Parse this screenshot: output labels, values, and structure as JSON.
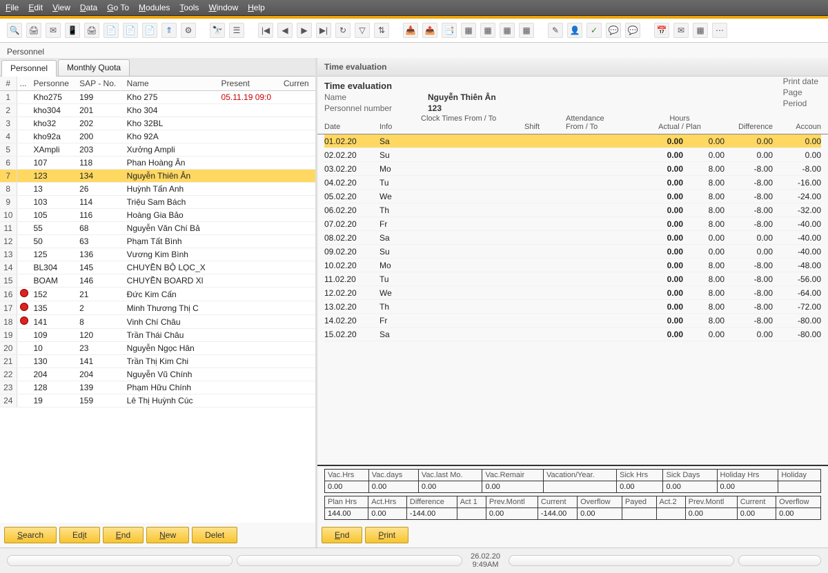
{
  "menu": [
    "File",
    "Edit",
    "View",
    "Data",
    "Go To",
    "Modules",
    "Tools",
    "Window",
    "Help"
  ],
  "crumb": "Personnel",
  "tabs": {
    "personnel": "Personnel",
    "quota": "Monthly Quota"
  },
  "left_cols": {
    "num": "#",
    "marker": "...",
    "personnel": "Personne",
    "sap": "SAP - No.",
    "name": "Name",
    "present": "Present",
    "current": "Curren"
  },
  "personnel_rows": [
    {
      "n": "1",
      "p": "Kho275",
      "sap": "199",
      "name": "Kho 275",
      "present": "05.11.19 09:0",
      "red": true
    },
    {
      "n": "2",
      "p": "kho304",
      "sap": "201",
      "name": "Kho 304"
    },
    {
      "n": "3",
      "p": "kho32",
      "sap": "202",
      "name": "Kho 32BL"
    },
    {
      "n": "4",
      "p": "kho92a",
      "sap": "200",
      "name": "Kho 92A"
    },
    {
      "n": "5",
      "p": "XAmpli",
      "sap": "203",
      "name": "Xưởng Ampli"
    },
    {
      "n": "6",
      "p": "107",
      "sap": "118",
      "name": "Phan Hoàng Ân"
    },
    {
      "n": "7",
      "p": "123",
      "sap": "134",
      "name": "Nguyễn Thiên Ân",
      "sel": true
    },
    {
      "n": "8",
      "p": "13",
      "sap": "26",
      "name": "Huỳnh Tấn Anh"
    },
    {
      "n": "9",
      "p": "103",
      "sap": "114",
      "name": "Triệu Sam Bách"
    },
    {
      "n": "10",
      "p": "105",
      "sap": "116",
      "name": "Hoàng Gia Bảo"
    },
    {
      "n": "11",
      "p": "55",
      "sap": "68",
      "name": "Nguyễn Văn Chí Bả"
    },
    {
      "n": "12",
      "p": "50",
      "sap": "63",
      "name": "Phạm Tất Bình"
    },
    {
      "n": "13",
      "p": "125",
      "sap": "136",
      "name": "Vương Kim Bình"
    },
    {
      "n": "14",
      "p": "BL304",
      "sap": "145",
      "name": "CHUYỀN BỘ LỌC_X"
    },
    {
      "n": "15",
      "p": "BOAM",
      "sap": "146",
      "name": "CHUYỀN BOARD Xl"
    },
    {
      "n": "16",
      "p": "152",
      "sap": "21",
      "name": "Đức Kim Cấn",
      "dot": true
    },
    {
      "n": "17",
      "p": "135",
      "sap": "2",
      "name": "Minh Thương Thị C",
      "dot": true
    },
    {
      "n": "18",
      "p": "141",
      "sap": "8",
      "name": "Vinh Chí Châu",
      "dot": true
    },
    {
      "n": "19",
      "p": "109",
      "sap": "120",
      "name": "Trần Thái Châu"
    },
    {
      "n": "20",
      "p": "10",
      "sap": "23",
      "name": "Nguyễn Ngọc Hân"
    },
    {
      "n": "21",
      "p": "130",
      "sap": "141",
      "name": "Trần Thị Kim Chi"
    },
    {
      "n": "22",
      "p": "204",
      "sap": "204",
      "name": "Nguyễn Vũ Chính"
    },
    {
      "n": "23",
      "p": "128",
      "sap": "139",
      "name": "Phạm Hữu Chính"
    },
    {
      "n": "24",
      "p": "19",
      "sap": "159",
      "name": "Lê Thị Huỳnh Cúc"
    }
  ],
  "left_buttons": {
    "search": "Search",
    "edit": "Edit",
    "end": "End",
    "new": "New",
    "delete": "Delet"
  },
  "right": {
    "panel_title": "Time evaluation",
    "title": "Time evaluation",
    "name_label": "Name",
    "name": "Nguyễn Thiên Ân",
    "pn_label": "Personnel number",
    "pn": "123",
    "meta": {
      "printdate": "Print date",
      "page": "Page",
      "period": "Period"
    },
    "head": {
      "date": "Date",
      "info": "Info",
      "clock": "Clock Times From / To",
      "shift": "Shift",
      "att": "Attendance\nFrom / To",
      "hours": "Hours",
      "actplan": "Actual / Plan",
      "diff": "Difference",
      "acc": "Accoun"
    },
    "rows": [
      {
        "d": "01.02.20",
        "day": "Sa",
        "act": "0.00",
        "plan": "0.00",
        "diff": "0.00",
        "acc": "0.00",
        "sel": true
      },
      {
        "d": "02.02.20",
        "day": "Su",
        "act": "0.00",
        "plan": "0.00",
        "diff": "0.00",
        "acc": "0.00"
      },
      {
        "d": "03.02.20",
        "day": "Mo",
        "act": "0.00",
        "plan": "8.00",
        "diff": "-8.00",
        "acc": "-8.00"
      },
      {
        "d": "04.02.20",
        "day": "Tu",
        "act": "0.00",
        "plan": "8.00",
        "diff": "-8.00",
        "acc": "-16.00"
      },
      {
        "d": "05.02.20",
        "day": "We",
        "act": "0.00",
        "plan": "8.00",
        "diff": "-8.00",
        "acc": "-24.00"
      },
      {
        "d": "06.02.20",
        "day": "Th",
        "act": "0.00",
        "plan": "8.00",
        "diff": "-8.00",
        "acc": "-32.00"
      },
      {
        "d": "07.02.20",
        "day": "Fr",
        "act": "0.00",
        "plan": "8.00",
        "diff": "-8.00",
        "acc": "-40.00"
      },
      {
        "d": "08.02.20",
        "day": "Sa",
        "act": "0.00",
        "plan": "0.00",
        "diff": "0.00",
        "acc": "-40.00"
      },
      {
        "d": "09.02.20",
        "day": "Su",
        "act": "0.00",
        "plan": "0.00",
        "diff": "0.00",
        "acc": "-40.00"
      },
      {
        "d": "10.02.20",
        "day": "Mo",
        "act": "0.00",
        "plan": "8.00",
        "diff": "-8.00",
        "acc": "-48.00"
      },
      {
        "d": "11.02.20",
        "day": "Tu",
        "act": "0.00",
        "plan": "8.00",
        "diff": "-8.00",
        "acc": "-56.00"
      },
      {
        "d": "12.02.20",
        "day": "We",
        "act": "0.00",
        "plan": "8.00",
        "diff": "-8.00",
        "acc": "-64.00"
      },
      {
        "d": "13.02.20",
        "day": "Th",
        "act": "0.00",
        "plan": "8.00",
        "diff": "-8.00",
        "acc": "-72.00"
      },
      {
        "d": "14.02.20",
        "day": "Fr",
        "act": "0.00",
        "plan": "8.00",
        "diff": "-8.00",
        "acc": "-80.00"
      },
      {
        "d": "15.02.20",
        "day": "Sa",
        "act": "0.00",
        "plan": "0.00",
        "diff": "0.00",
        "acc": "-80.00"
      }
    ],
    "summary1_head": [
      "Vac.Hrs",
      "Vac.days",
      "Vac.last Mo.",
      "Vac.Remair",
      "Vacation/Year.",
      "Sick Hrs",
      "Sick Days",
      "Holiday Hrs",
      "Holiday"
    ],
    "summary1_row": [
      "0.00",
      "0.00",
      "0.00",
      "0.00",
      "",
      "0.00",
      "0.00",
      "0.00",
      ""
    ],
    "summary2_head": [
      "Plan Hrs",
      "Act.Hrs",
      "Difference",
      "Act 1",
      "Prev.Montl",
      "Current",
      "Overflow",
      "Payed",
      "Act.2",
      "Prev.Montl",
      "Current",
      "Overflow"
    ],
    "summary2_row": [
      "144.00",
      "0.00",
      "-144.00",
      "",
      "0.00",
      "-144.00",
      "0.00",
      "",
      "",
      "0.00",
      "0.00",
      "0.00"
    ],
    "buttons": {
      "end": "End",
      "print": "Print"
    }
  },
  "status": {
    "date": "26.02.20",
    "time": "9:49AM"
  }
}
